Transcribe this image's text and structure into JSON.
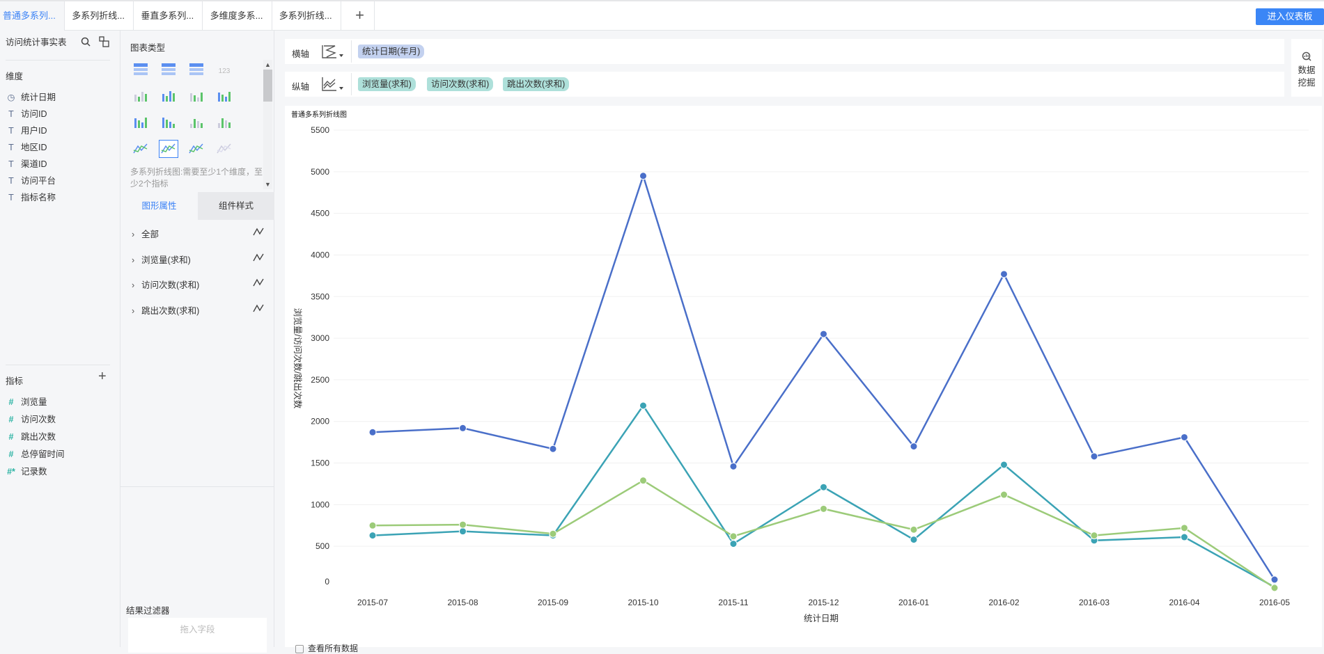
{
  "tabs": [
    "普通多系列...",
    "多系列折线...",
    "垂直多系列...",
    "多维度多系...",
    "多系列折线..."
  ],
  "add_tab": "+",
  "dashboard_button": "进入仪表板",
  "left": {
    "table_name": "访问统计事实表",
    "dimensions_label": "维度",
    "dimensions": [
      {
        "icon": "clock-icon",
        "glyph": "◷",
        "label": "统计日期"
      },
      {
        "icon": "text-icon",
        "glyph": "T",
        "label": "访问ID"
      },
      {
        "icon": "text-icon",
        "glyph": "T",
        "label": "用户ID"
      },
      {
        "icon": "text-icon",
        "glyph": "T",
        "label": "地区ID"
      },
      {
        "icon": "text-icon",
        "glyph": "T",
        "label": "渠道ID"
      },
      {
        "icon": "text-icon",
        "glyph": "T",
        "label": "访问平台"
      },
      {
        "icon": "text-icon",
        "glyph": "T",
        "label": "指标名称"
      }
    ],
    "metrics_label": "指标",
    "add": "+",
    "metrics": [
      {
        "glyph": "#",
        "label": "浏览量"
      },
      {
        "glyph": "#",
        "label": "访问次数"
      },
      {
        "glyph": "#",
        "label": "跳出次数"
      },
      {
        "glyph": "#",
        "label": "总停留时间"
      },
      {
        "glyph": "#*",
        "label": "记录数"
      }
    ]
  },
  "mid": {
    "chart_type_label": "图表类型",
    "description": "多系列折线图:需要至少1个维度，至少2个指标",
    "tabs": [
      "图形属性",
      "组件样式"
    ],
    "props": [
      "全部",
      "浏览量(求和)",
      "访问次数(求和)",
      "跳出次数(求和)"
    ],
    "filter_label": "结果过滤器",
    "filter_placeholder": "拖入字段",
    "numeric_icon_text": "123"
  },
  "axes": {
    "x_label": "横轴",
    "x_fields": [
      "统计日期(年月)"
    ],
    "y_label": "纵轴",
    "y_fields": [
      "浏览量(求和)",
      "访问次数(求和)",
      "跳出次数(求和)"
    ]
  },
  "data_mining": "数据挖掘",
  "view_all": "查看所有数据",
  "colors": {
    "accent": "#3b82f6",
    "s1": "#4a6fc9",
    "s2": "#3ba3b5",
    "s3": "#9ccb79",
    "xpill": "#c3d1ef",
    "ypill": "#aee0da"
  },
  "chart_data": {
    "type": "line",
    "title": "普通多系列折线图",
    "xlabel": "统计日期",
    "ylabel": "浏览量/访问次数/跳出次数",
    "ylim": [
      0,
      5500
    ],
    "yticks": [
      0,
      500,
      1000,
      1500,
      2000,
      2500,
      3000,
      3500,
      4000,
      4500,
      5000,
      5500
    ],
    "categories": [
      "2015-07",
      "2015-08",
      "2015-09",
      "2015-10",
      "2015-11",
      "2015-12",
      "2016-01",
      "2016-02",
      "2016-03",
      "2016-04",
      "2016-05"
    ],
    "series": [
      {
        "name": "浏览量(求和)",
        "color": "#4a6fc9",
        "values": [
          1870,
          1920,
          1670,
          4950,
          1460,
          3050,
          1700,
          3770,
          1580,
          1810,
          100
        ]
      },
      {
        "name": "访问次数(求和)",
        "color": "#3ba3b5",
        "values": [
          630,
          680,
          630,
          2190,
          530,
          1210,
          580,
          1480,
          570,
          610,
          10
        ]
      },
      {
        "name": "跳出次数(求和)",
        "color": "#9ccb79",
        "values": [
          750,
          760,
          650,
          1290,
          620,
          950,
          700,
          1120,
          630,
          720,
          0
        ]
      }
    ],
    "grid": true
  }
}
